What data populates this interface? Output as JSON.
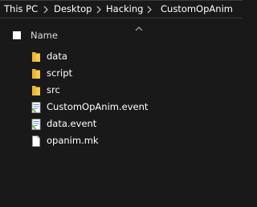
{
  "breadcrumb": {
    "items": [
      {
        "label": "This PC"
      },
      {
        "label": "Desktop"
      },
      {
        "label": "Hacking"
      },
      {
        "label": "CustomOpAnim"
      }
    ]
  },
  "list_header": {
    "name_label": "Name",
    "sort_icon": "chevron-up-icon"
  },
  "files": [
    {
      "name": "data",
      "type": "folder",
      "icon": "folder-icon"
    },
    {
      "name": "script",
      "type": "folder",
      "icon": "folder-icon"
    },
    {
      "name": "src",
      "type": "folder",
      "icon": "folder-icon"
    },
    {
      "name": "CustomOpAnim.event",
      "type": "event",
      "icon": "event-file-icon"
    },
    {
      "name": "data.event",
      "type": "event",
      "icon": "event-file-icon"
    },
    {
      "name": "opanim.mk",
      "type": "file",
      "icon": "blank-file-icon"
    }
  ],
  "colors": {
    "background": "#191919",
    "folder": "#f6c94c",
    "text": "#ffffff"
  }
}
